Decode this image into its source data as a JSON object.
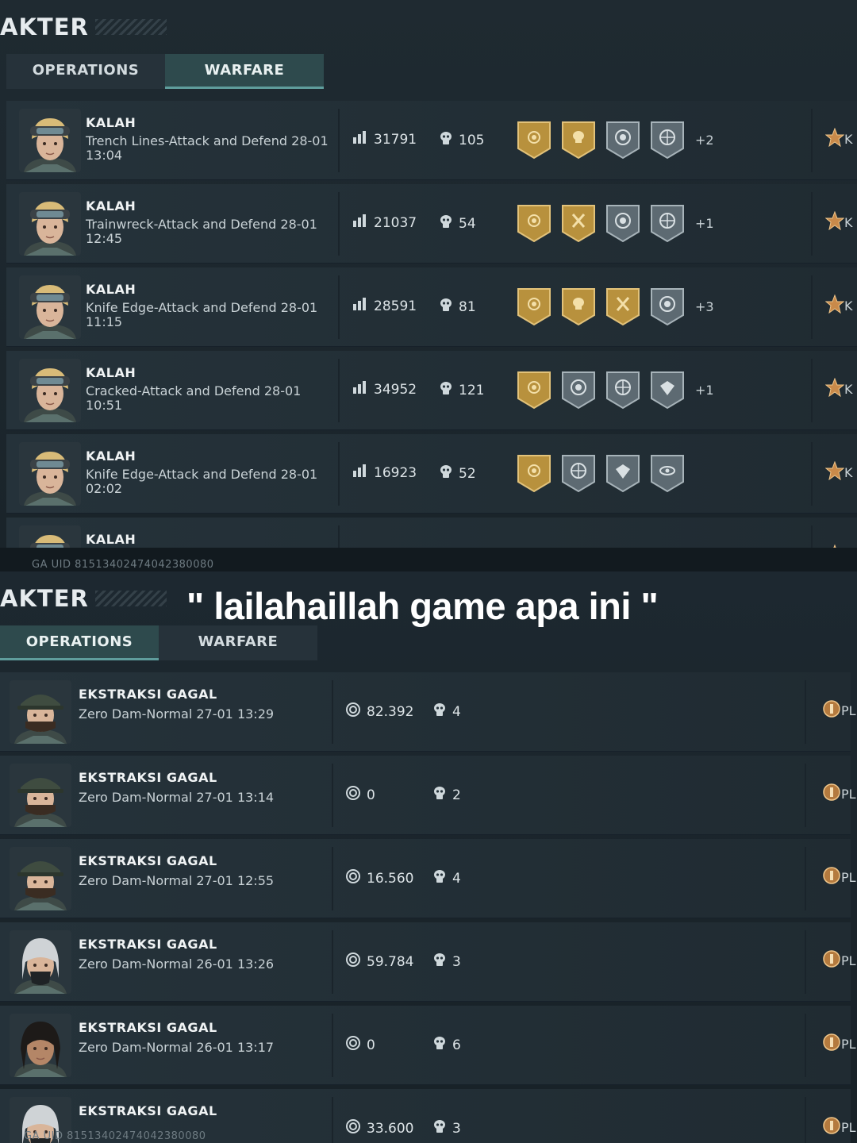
{
  "top": {
    "header": "AKTER",
    "tabs": [
      {
        "label": "OPERATIONS",
        "active": false
      },
      {
        "label": "WARFARE",
        "active": true
      }
    ],
    "rows": [
      {
        "title": "KALAH",
        "subtitle": "Trench Lines-Attack and Defend 28-01 13:04",
        "score": "31791",
        "kills": "105",
        "badges": [
          "gold-rose",
          "gold-skull",
          "silver-target",
          "silver-scope"
        ],
        "extra": "+2",
        "rank_icon": "rank-star-icon",
        "rank_text": "K"
      },
      {
        "title": "KALAH",
        "subtitle": "Trainwreck-Attack and Defend 28-01 12:45",
        "score": "21037",
        "kills": "54",
        "badges": [
          "gold-rose",
          "gold-axes",
          "silver-target",
          "silver-scope"
        ],
        "extra": "+1",
        "rank_icon": "rank-star-icon",
        "rank_text": "K"
      },
      {
        "title": "KALAH",
        "subtitle": "Knife Edge-Attack and Defend 28-01 11:15",
        "score": "28591",
        "kills": "81",
        "badges": [
          "gold-rose",
          "gold-skull",
          "gold-axes",
          "silver-target"
        ],
        "extra": "+3",
        "rank_icon": "rank-star-icon",
        "rank_text": "K"
      },
      {
        "title": "KALAH",
        "subtitle": "Cracked-Attack and Defend 28-01 10:51",
        "score": "34952",
        "kills": "121",
        "badges": [
          "gold-rose",
          "silver-target",
          "silver-scope",
          "silver-wings"
        ],
        "extra": "+1",
        "rank_icon": "rank-star-icon",
        "rank_text": "K"
      },
      {
        "title": "KALAH",
        "subtitle": "Knife Edge-Attack and Defend 28-01 02:02",
        "score": "16923",
        "kills": "52",
        "badges": [
          "gold-rose",
          "silver-scope",
          "silver-wings",
          "silver-eye"
        ],
        "extra": "",
        "rank_icon": "rank-star-icon",
        "rank_text": "K"
      },
      {
        "title": "KALAH",
        "subtitle": "",
        "score": "",
        "kills": "",
        "badges": [],
        "extra": "",
        "rank_icon": "rank-star-icon",
        "rank_text": ""
      }
    ],
    "uid": "GA UID 81513402474042380080"
  },
  "caption": "\" lailahaillah game apa ini \"",
  "bottom": {
    "header": "AKTER",
    "tabs": [
      {
        "label": "OPERATIONS",
        "active": true
      },
      {
        "label": "WARFARE",
        "active": false
      }
    ],
    "rows": [
      {
        "title": "EKSTRAKSI GAGAL",
        "subtitle": "Zero Dam-Normal 27-01 13:29",
        "value": "82.392",
        "kills": "4",
        "rank_text": "PL",
        "avatar": "male-cap"
      },
      {
        "title": "EKSTRAKSI GAGAL",
        "subtitle": "Zero Dam-Normal 27-01 13:14",
        "value": "0",
        "kills": "2",
        "rank_text": "PL",
        "avatar": "male-cap"
      },
      {
        "title": "EKSTRAKSI GAGAL",
        "subtitle": "Zero Dam-Normal 27-01 12:55",
        "value": "16.560",
        "kills": "4",
        "rank_text": "PL",
        "avatar": "male-cap"
      },
      {
        "title": "EKSTRAKSI GAGAL",
        "subtitle": "Zero Dam-Normal 26-01 13:26",
        "value": "59.784",
        "kills": "3",
        "rank_text": "PL",
        "avatar": "female-mask"
      },
      {
        "title": "EKSTRAKSI GAGAL",
        "subtitle": "Zero Dam-Normal 26-01 13:17",
        "value": "0",
        "kills": "6",
        "rank_text": "PL",
        "avatar": "female-dark"
      },
      {
        "title": "EKSTRAKSI GAGAL",
        "subtitle": "",
        "value": "33.600",
        "kills": "3",
        "rank_text": "PL",
        "avatar": "female-mask"
      }
    ],
    "uid": "GA UID 81513402474042380080"
  },
  "colors": {
    "gold_badge": "#b8913d",
    "silver_badge": "#5d6a72",
    "active_tab": "#2e4a4d",
    "accent": "#5f9d9c"
  }
}
